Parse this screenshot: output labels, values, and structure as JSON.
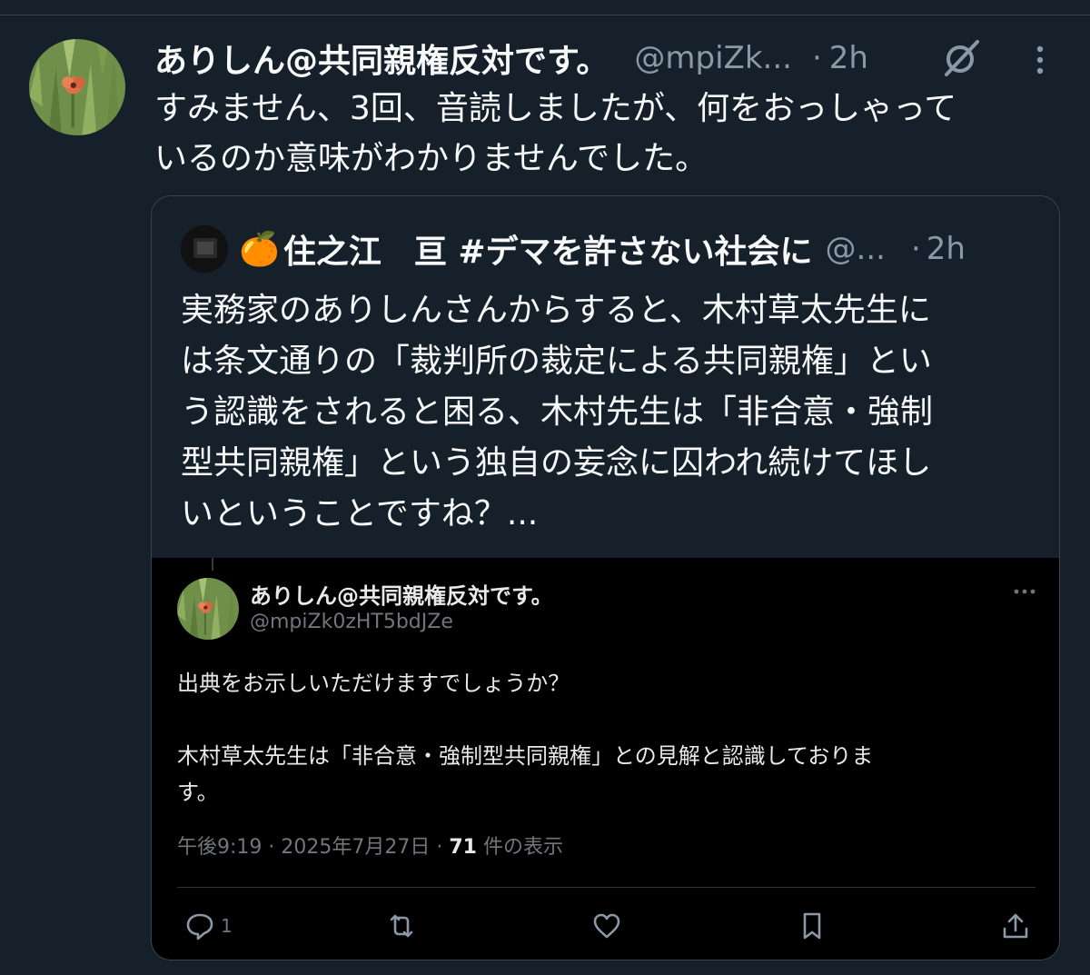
{
  "colors": {
    "background": "#15202b",
    "text": "#f7f9f9",
    "muted": "#8b98a5",
    "border": "#38444d",
    "screenshot_bg": "#000000"
  },
  "tweet": {
    "display_name": "ありしん@共同親権反対です。",
    "handle": "@mpiZk...",
    "separator": "·",
    "time": "2h",
    "lines": [
      "すみません、3回、音読しましたが、何をおっしゃって",
      "いるのか意味がわかりませんでした。"
    ],
    "icons": [
      "avatar-flower",
      "grok-icon",
      "more-vertical-icon"
    ]
  },
  "quote": {
    "emoji": "🍊",
    "display_name": "住之江　亘 #デマを許さない社会に",
    "handle": "@...",
    "separator": "·",
    "time": "2h",
    "lines": [
      "実務家のありしんさんからすると、木村草太先生に",
      "は条文通りの「裁判所の裁定による共同親権」とい",
      "う認識をされると困る、木村先生は「非合意・強制",
      "型共同親権」という独自の妄念に囚われ続けてほし",
      "いということですね？..."
    ],
    "screenshot": {
      "display_name": "ありしん@共同親権反対です。",
      "handle": "@mpiZk0zHT5bdJZe",
      "para1": "出典をお示しいただけますでしょうか？",
      "para2_line1": "木村草太先生は「非合意・強制型共同親権」との見解と認識しておりま",
      "para2_line2": "す。",
      "time_date": "午後9:19 · 2025年7月27日 · ",
      "views": "71",
      "views_suffix": " 件の表示",
      "reply_count": "1",
      "icons": [
        "reply-icon",
        "retweet-icon",
        "like-icon",
        "bookmark-icon",
        "share-icon",
        "more-horizontal-icon"
      ]
    }
  }
}
